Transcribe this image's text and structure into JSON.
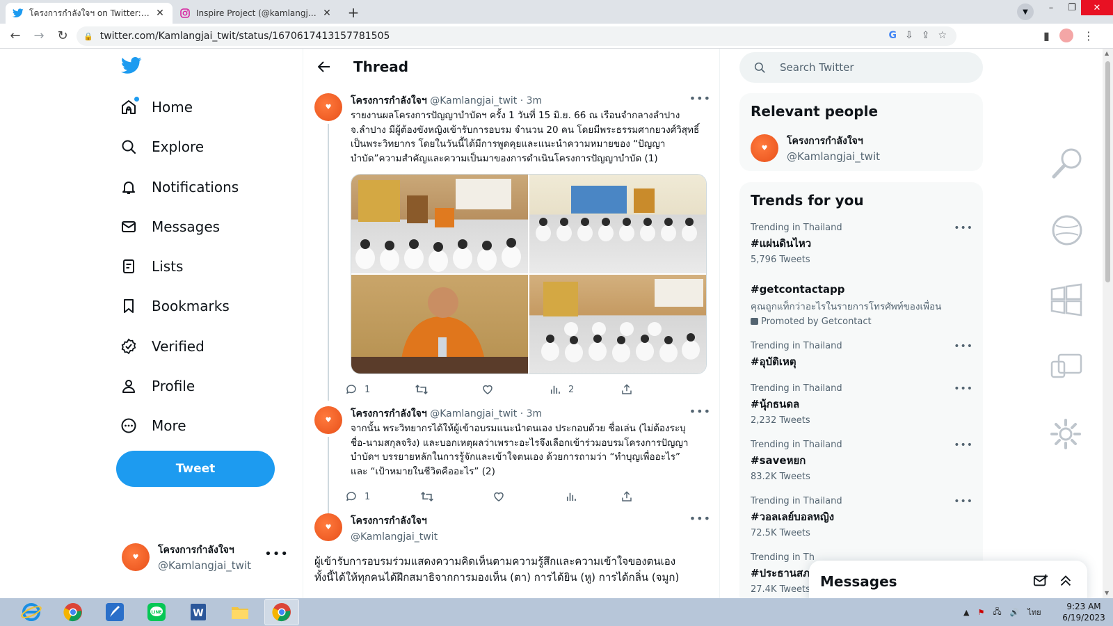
{
  "browser": {
    "tabs": [
      {
        "title": "โครงการกำลังใจฯ on Twitter: \"ผู้เข้าร่",
        "active": true
      },
      {
        "title": "Inspire Project (@kamlangjai.insp",
        "active": false
      }
    ],
    "url": "twitter.com/Kamlangjai_twit/status/1670617413157781505"
  },
  "nav": {
    "items": [
      {
        "label": "Home",
        "icon": "home-icon"
      },
      {
        "label": "Explore",
        "icon": "search-icon"
      },
      {
        "label": "Notifications",
        "icon": "bell-icon"
      },
      {
        "label": "Messages",
        "icon": "envelope-icon"
      },
      {
        "label": "Lists",
        "icon": "list-icon"
      },
      {
        "label": "Bookmarks",
        "icon": "bookmark-icon"
      },
      {
        "label": "Verified",
        "icon": "verified-icon"
      },
      {
        "label": "Profile",
        "icon": "person-icon"
      },
      {
        "label": "More",
        "icon": "more-circle-icon"
      }
    ],
    "tweet_button": "Tweet",
    "account": {
      "name": "โครงการกำลังใจฯ",
      "handle": "@Kamlangjai_twit"
    }
  },
  "thread": {
    "title": "Thread",
    "tweets": [
      {
        "name": "โครงการกำลังใจฯ",
        "handle": "@Kamlangjai_twit",
        "time": "· 3m",
        "lines": [
          "รายงานผลโครงการปัญญาบำบัดฯ ครั้ง 1 วันที่ 15 มิ.ย. 66 ณ เรือนจำกลางลำปาง",
          "จ.ลำปาง มีผู้ต้องขังหญิงเข้ารับการอบรม จำนวน 20 คน โดยมีพระธรรมศากยวงศ์วิสุทธิ์",
          "เป็นพระวิทยากร โดยในวันนี้ได้มีการพูดคุยและแนะนำความหมายของ “ปัญญา",
          "บำบัด”ความสำคัญและความเป็นมาของการดำเนินโครงการปัญญาบำบัด (1)"
        ],
        "replies": "1",
        "retweets": "",
        "likes": "",
        "views": "2"
      },
      {
        "name": "โครงการกำลังใจฯ",
        "handle": "@Kamlangjai_twit",
        "time": "· 3m",
        "lines": [
          "จากนั้น พระวิทยากรได้ให้ผู้เข้าอบรมแนะนำตนเอง ประกอบด้วย ชื่อเล่น (ไม่ต้องระบุ",
          "ชื่อ-นามสกุลจริง) และบอกเหตุผลว่าเพราะอะไรจึงเลือกเข้าร่วมอบรมโครงการปัญญา",
          "บำบัดฯ บรรยายหลักในการรู้จักและเข้าใจตนเอง ด้วยการถามว่า “ทำบุญเพื่ออะไร”",
          "และ “เป้าหมายในชีวิตคืออะไร” (2)"
        ],
        "replies": "1",
        "retweets": "",
        "likes": "",
        "views": ""
      },
      {
        "name": "โครงการกำลังใจฯ",
        "handle": "@Kamlangjai_twit",
        "lines": [
          "ผู้เข้ารับการอบรมร่วมแสดงความคิดเห็นตามความรู้สึกและความเข้าใจของตนเอง",
          "ทั้งนี้ได้ให้ทุกคนได้ฝึกสมาธิจากการมองเห็น (ตา) การได้ยิน (หู) การได้กลิ่น (จมูก)"
        ]
      }
    ]
  },
  "right": {
    "search_placeholder": "Search Twitter",
    "relevant": {
      "title": "Relevant people",
      "name": "โครงการกำลังใจฯ",
      "handle": "@Kamlangjai_twit"
    },
    "trends": {
      "title": "Trends for you",
      "items": [
        {
          "meta": "Trending in Thailand",
          "tag": "#แผ่นดินไหว",
          "count": "5,796 Tweets"
        },
        {
          "meta": "",
          "tag": "#getcontactapp",
          "desc": "คุณถูกแท็กว่าอะไรในรายการโทรศัพท์ของเพื่อน",
          "promo": "Promoted by Getcontact"
        },
        {
          "meta": "Trending in Thailand",
          "tag": "#อุบัติเหตุ",
          "count": ""
        },
        {
          "meta": "Trending in Thailand",
          "tag": "#นุ้กธนดล",
          "count": "2,232 Tweets"
        },
        {
          "meta": "Trending in Thailand",
          "tag": "#saveหยก",
          "count": "83.2K Tweets"
        },
        {
          "meta": "Trending in Thailand",
          "tag": "#วอลเลย์บอลหญิง",
          "count": "72.5K Tweets"
        },
        {
          "meta": "Trending in Th",
          "tag": "#ประธานสภ",
          "count": "27.4K Tweets"
        }
      ]
    },
    "messages_title": "Messages"
  },
  "taskbar": {
    "lang": "ไทย",
    "time": "9:23 AM",
    "date": "6/19/2023"
  },
  "colors": {
    "accent": "#1d9bf0",
    "brand_orange": "#e8501a"
  }
}
